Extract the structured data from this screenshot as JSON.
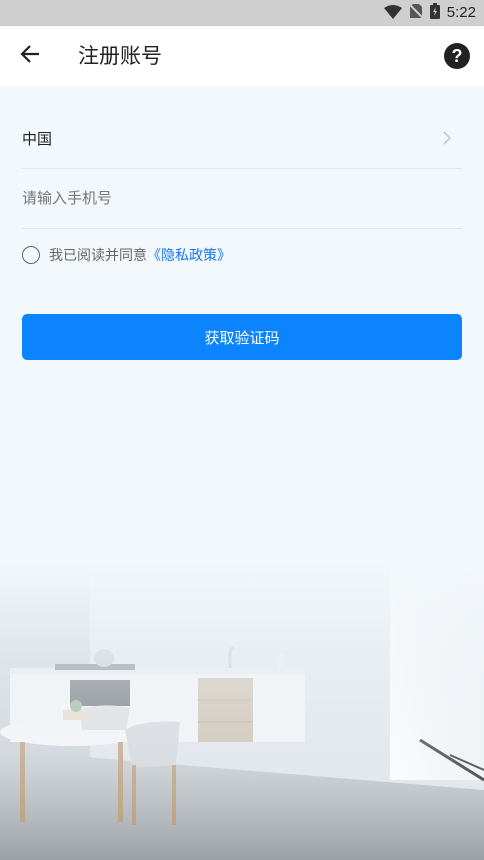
{
  "status_bar": {
    "time": "5:22",
    "icons": [
      "wifi-icon",
      "no-sim-icon",
      "battery-charging-icon"
    ]
  },
  "app_bar": {
    "back_icon": "back-arrow-icon",
    "title": "注册账号",
    "help_icon": "help-icon",
    "help_glyph": "?"
  },
  "form": {
    "country": "中国",
    "country_chevron_icon": "chevron-right-icon",
    "phone_placeholder": "请输入手机号",
    "phone_value": "",
    "agreement": {
      "checked": false,
      "text": "我已阅读并同意",
      "link_text": "《隐私政策》"
    },
    "submit_label": "获取验证码"
  },
  "colors": {
    "accent": "#0d84ff",
    "link": "#1677ff",
    "background": "#f3f8fc",
    "appbar": "#ffffff",
    "statusbar": "#cfcfcf"
  }
}
